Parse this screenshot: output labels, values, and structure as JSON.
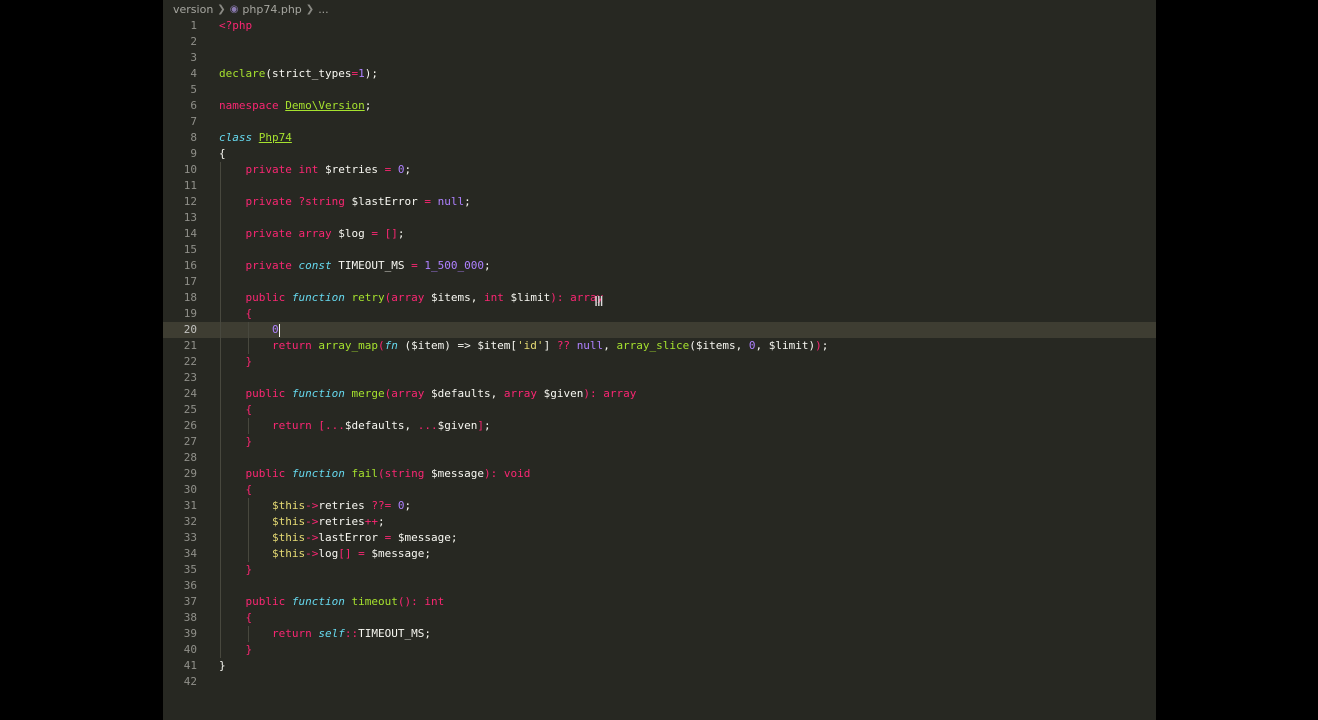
{
  "breadcrumb": {
    "folder": "version",
    "file": "php74.php",
    "more": "...",
    "file_icon": "php-file-icon"
  },
  "theme": {
    "background": "#272822",
    "current_line": "#3e3d32",
    "keyword": "#f92672",
    "storage": "#66d9ef",
    "function": "#a6e22e",
    "number": "#ae81ff",
    "string": "#e6db74"
  },
  "current_line": 20,
  "lines": [
    {
      "n": "1",
      "t": [
        [
          "k",
          "<?php"
        ]
      ]
    },
    {
      "n": "2",
      "t": []
    },
    {
      "n": "3",
      "t": []
    },
    {
      "n": "4",
      "t": [
        [
          "f",
          "declare"
        ],
        [
          "p",
          "(strict_types"
        ],
        [
          "k",
          "="
        ],
        [
          "n",
          "1"
        ],
        [
          "p",
          ");"
        ]
      ]
    },
    {
      "n": "5",
      "t": []
    },
    {
      "n": "6",
      "t": [
        [
          "k",
          "namespace"
        ],
        [
          "p",
          " "
        ],
        [
          "c",
          "Demo\\Version"
        ],
        [
          "p",
          ";"
        ]
      ]
    },
    {
      "n": "7",
      "t": []
    },
    {
      "n": "8",
      "t": [
        [
          "s",
          "class"
        ],
        [
          "p",
          " "
        ],
        [
          "c",
          "Php74"
        ]
      ]
    },
    {
      "n": "9",
      "t": [
        [
          "p",
          "{"
        ]
      ]
    },
    {
      "n": "10",
      "t": [
        [
          "p",
          "    "
        ],
        [
          "k",
          "private"
        ],
        [
          "p",
          " "
        ],
        [
          "k",
          "int"
        ],
        [
          "p",
          " $retries "
        ],
        [
          "k",
          "="
        ],
        [
          "p",
          " "
        ],
        [
          "n",
          "0"
        ],
        [
          "p",
          ";"
        ]
      ]
    },
    {
      "n": "11",
      "t": []
    },
    {
      "n": "12",
      "t": [
        [
          "p",
          "    "
        ],
        [
          "k",
          "private"
        ],
        [
          "p",
          " "
        ],
        [
          "k",
          "?string"
        ],
        [
          "p",
          " $lastError "
        ],
        [
          "k",
          "="
        ],
        [
          "p",
          " "
        ],
        [
          "n",
          "null"
        ],
        [
          "p",
          ";"
        ]
      ]
    },
    {
      "n": "13",
      "t": []
    },
    {
      "n": "14",
      "t": [
        [
          "p",
          "    "
        ],
        [
          "k",
          "private"
        ],
        [
          "p",
          " "
        ],
        [
          "k",
          "array"
        ],
        [
          "p",
          " $log "
        ],
        [
          "k",
          "="
        ],
        [
          "p",
          " "
        ],
        [
          "k",
          "[]"
        ],
        [
          "p",
          ";"
        ]
      ]
    },
    {
      "n": "15",
      "t": []
    },
    {
      "n": "16",
      "t": [
        [
          "p",
          "    "
        ],
        [
          "k",
          "private"
        ],
        [
          "p",
          " "
        ],
        [
          "s",
          "const"
        ],
        [
          "p",
          " TIMEOUT_MS "
        ],
        [
          "k",
          "="
        ],
        [
          "p",
          " "
        ],
        [
          "n",
          "1_500_000"
        ],
        [
          "p",
          ";"
        ]
      ]
    },
    {
      "n": "17",
      "t": []
    },
    {
      "n": "18",
      "t": [
        [
          "p",
          "    "
        ],
        [
          "k",
          "public"
        ],
        [
          "p",
          " "
        ],
        [
          "s",
          "function"
        ],
        [
          "p",
          " "
        ],
        [
          "f",
          "retry"
        ],
        [
          "k",
          "("
        ],
        [
          "k",
          "array"
        ],
        [
          "p",
          " $items, "
        ],
        [
          "k",
          "int"
        ],
        [
          "p",
          " $limit"
        ],
        [
          "k",
          ")"
        ],
        [
          "k",
          ": array"
        ]
      ]
    },
    {
      "n": "19",
      "t": [
        [
          "p",
          "    "
        ],
        [
          "k",
          "{"
        ]
      ]
    },
    {
      "n": "20",
      "t": [
        [
          "p",
          "        "
        ],
        [
          "n",
          "0"
        ],
        [
          "caret",
          ""
        ]
      ]
    },
    {
      "n": "21",
      "t": [
        [
          "p",
          "        "
        ],
        [
          "k",
          "return"
        ],
        [
          "p",
          " "
        ],
        [
          "f",
          "array_map"
        ],
        [
          "k",
          "("
        ],
        [
          "s",
          "fn"
        ],
        [
          "p",
          " ($item) => $item["
        ],
        [
          "str",
          "'id'"
        ],
        [
          "p",
          "] "
        ],
        [
          "k",
          "??"
        ],
        [
          "p",
          " "
        ],
        [
          "n",
          "null"
        ],
        [
          "p",
          ", "
        ],
        [
          "f",
          "array_slice"
        ],
        [
          "p",
          "($items, "
        ],
        [
          "n",
          "0"
        ],
        [
          "p",
          ", $limit)"
        ],
        [
          "k",
          ")"
        ],
        [
          "p",
          ";"
        ]
      ]
    },
    {
      "n": "22",
      "t": [
        [
          "p",
          "    "
        ],
        [
          "k",
          "}"
        ]
      ]
    },
    {
      "n": "23",
      "t": []
    },
    {
      "n": "24",
      "t": [
        [
          "p",
          "    "
        ],
        [
          "k",
          "public"
        ],
        [
          "p",
          " "
        ],
        [
          "s",
          "function"
        ],
        [
          "p",
          " "
        ],
        [
          "f",
          "merge"
        ],
        [
          "k",
          "("
        ],
        [
          "k",
          "array"
        ],
        [
          "p",
          " $defaults, "
        ],
        [
          "k",
          "array"
        ],
        [
          "p",
          " $given"
        ],
        [
          "k",
          ")"
        ],
        [
          "k",
          ": array"
        ]
      ]
    },
    {
      "n": "25",
      "t": [
        [
          "p",
          "    "
        ],
        [
          "k",
          "{"
        ]
      ]
    },
    {
      "n": "26",
      "t": [
        [
          "p",
          "        "
        ],
        [
          "k",
          "return"
        ],
        [
          "p",
          " "
        ],
        [
          "k",
          "["
        ],
        [
          "k",
          "..."
        ],
        [
          "p",
          "$defaults, "
        ],
        [
          "k",
          "..."
        ],
        [
          "p",
          "$given"
        ],
        [
          "k",
          "]"
        ],
        [
          "p",
          ";"
        ]
      ]
    },
    {
      "n": "27",
      "t": [
        [
          "p",
          "    "
        ],
        [
          "k",
          "}"
        ]
      ]
    },
    {
      "n": "28",
      "t": []
    },
    {
      "n": "29",
      "t": [
        [
          "p",
          "    "
        ],
        [
          "k",
          "public"
        ],
        [
          "p",
          " "
        ],
        [
          "s",
          "function"
        ],
        [
          "p",
          " "
        ],
        [
          "f",
          "fail"
        ],
        [
          "k",
          "("
        ],
        [
          "k",
          "string"
        ],
        [
          "p",
          " $message"
        ],
        [
          "k",
          ")"
        ],
        [
          "k",
          ": void"
        ]
      ]
    },
    {
      "n": "30",
      "t": [
        [
          "p",
          "    "
        ],
        [
          "k",
          "{"
        ]
      ]
    },
    {
      "n": "31",
      "t": [
        [
          "p",
          "        "
        ],
        [
          "str",
          "$this"
        ],
        [
          "k",
          "->"
        ],
        [
          "p",
          "retries "
        ],
        [
          "k",
          "??="
        ],
        [
          "p",
          " "
        ],
        [
          "n",
          "0"
        ],
        [
          "p",
          ";"
        ]
      ]
    },
    {
      "n": "32",
      "t": [
        [
          "p",
          "        "
        ],
        [
          "str",
          "$this"
        ],
        [
          "k",
          "->"
        ],
        [
          "p",
          "retries"
        ],
        [
          "k",
          "++"
        ],
        [
          "p",
          ";"
        ]
      ]
    },
    {
      "n": "33",
      "t": [
        [
          "p",
          "        "
        ],
        [
          "str",
          "$this"
        ],
        [
          "k",
          "->"
        ],
        [
          "p",
          "lastError "
        ],
        [
          "k",
          "="
        ],
        [
          "p",
          " $message;"
        ]
      ]
    },
    {
      "n": "34",
      "t": [
        [
          "p",
          "        "
        ],
        [
          "str",
          "$this"
        ],
        [
          "k",
          "->"
        ],
        [
          "p",
          "log"
        ],
        [
          "k",
          "[]"
        ],
        [
          "p",
          " "
        ],
        [
          "k",
          "="
        ],
        [
          "p",
          " $message;"
        ]
      ]
    },
    {
      "n": "35",
      "t": [
        [
          "p",
          "    "
        ],
        [
          "k",
          "}"
        ]
      ]
    },
    {
      "n": "36",
      "t": []
    },
    {
      "n": "37",
      "t": [
        [
          "p",
          "    "
        ],
        [
          "k",
          "public"
        ],
        [
          "p",
          " "
        ],
        [
          "s",
          "function"
        ],
        [
          "p",
          " "
        ],
        [
          "f",
          "timeout"
        ],
        [
          "k",
          "()"
        ],
        [
          "k",
          ": int"
        ]
      ]
    },
    {
      "n": "38",
      "t": [
        [
          "p",
          "    "
        ],
        [
          "k",
          "{"
        ]
      ]
    },
    {
      "n": "39",
      "t": [
        [
          "p",
          "        "
        ],
        [
          "k",
          "return"
        ],
        [
          "p",
          " "
        ],
        [
          "s",
          "self"
        ],
        [
          "k",
          "::"
        ],
        [
          "p",
          "TIMEOUT_MS;"
        ]
      ]
    },
    {
      "n": "40",
      "t": [
        [
          "p",
          "    "
        ],
        [
          "k",
          "}"
        ]
      ]
    },
    {
      "n": "41",
      "t": [
        [
          "p",
          "}"
        ]
      ]
    },
    {
      "n": "42",
      "t": []
    }
  ]
}
